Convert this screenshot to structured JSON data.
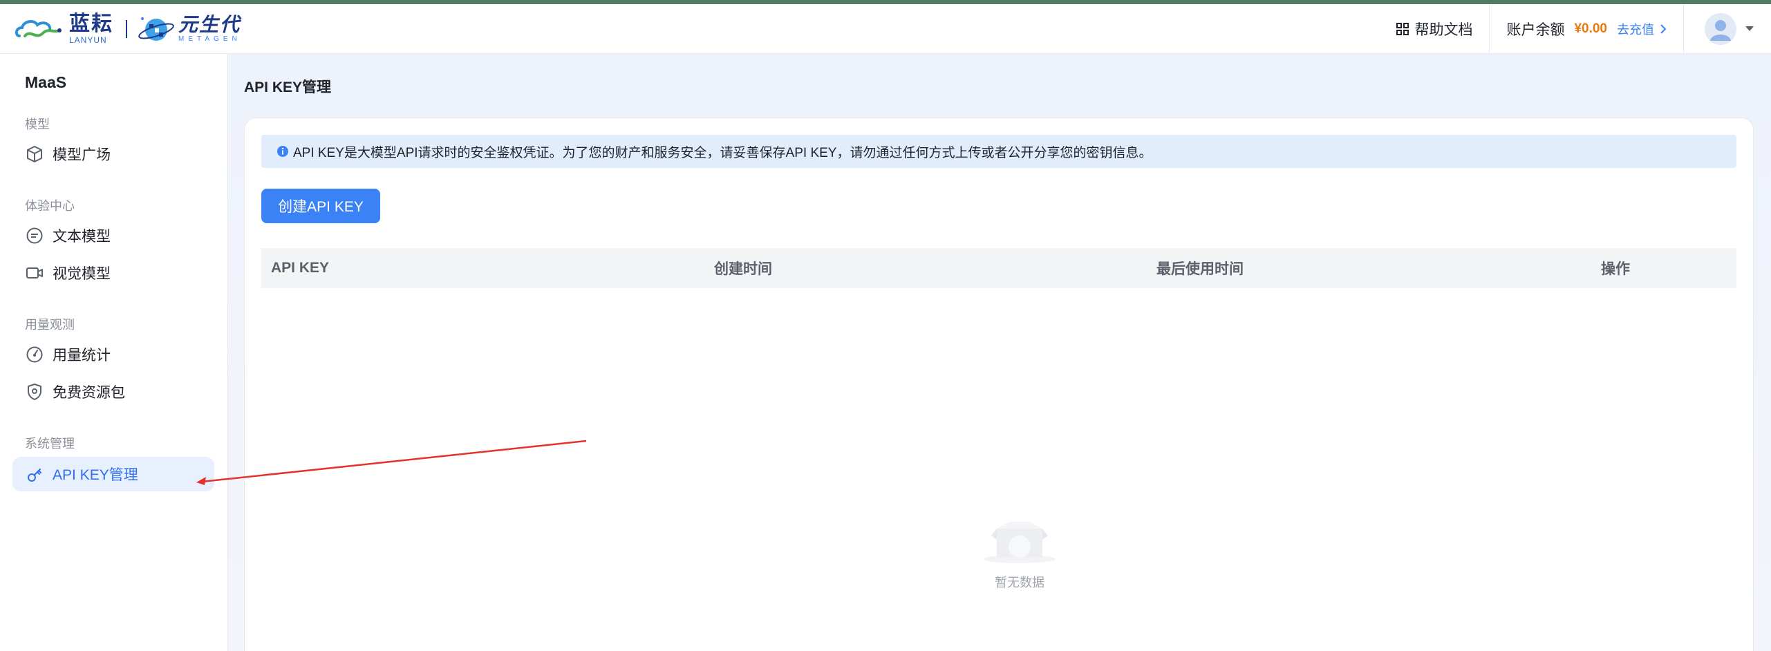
{
  "header": {
    "brand_name": "蓝耘",
    "brand_en": "LANYUN",
    "partner_name": "元生代",
    "partner_en": "METAGEN",
    "help_docs": "帮助文档",
    "balance_label": "账户余额",
    "balance_value": "¥0.00",
    "recharge": "去充值",
    "icons": {
      "help": "grid-icon",
      "recharge": "chevron-right-icon",
      "user": "avatar",
      "menu": "caret-down-icon"
    }
  },
  "sidebar": {
    "title": "MaaS",
    "sections": [
      {
        "label": "模型",
        "items": [
          {
            "label": "模型广场",
            "icon": "cube-icon"
          }
        ]
      },
      {
        "label": "体验中心",
        "items": [
          {
            "label": "文本模型",
            "icon": "chat-icon"
          },
          {
            "label": "视觉模型",
            "icon": "video-icon"
          }
        ]
      },
      {
        "label": "用量观测",
        "items": [
          {
            "label": "用量统计",
            "icon": "gauge-icon"
          },
          {
            "label": "免费资源包",
            "icon": "shield-icon"
          }
        ]
      },
      {
        "label": "系统管理",
        "items": [
          {
            "label": "API KEY管理",
            "icon": "key-icon",
            "active": true
          }
        ]
      }
    ]
  },
  "main": {
    "page_title": "API KEY管理",
    "notice": "API KEY是大模型API请求时的安全鉴权凭证。为了您的财产和服务安全，请妥善保存API KEY，请勿通过任何方式上传或者公开分享您的密钥信息。",
    "create_button": "创建API KEY",
    "table": {
      "columns": [
        "API KEY",
        "创建时间",
        "最后使用时间",
        "操作"
      ],
      "rows": []
    },
    "empty_text": "暂无数据"
  },
  "colors": {
    "accent": "#3b82f6",
    "active_bg": "#e8f0fe",
    "balance": "#e8790c",
    "annotation_arrow": "#e5322d"
  }
}
